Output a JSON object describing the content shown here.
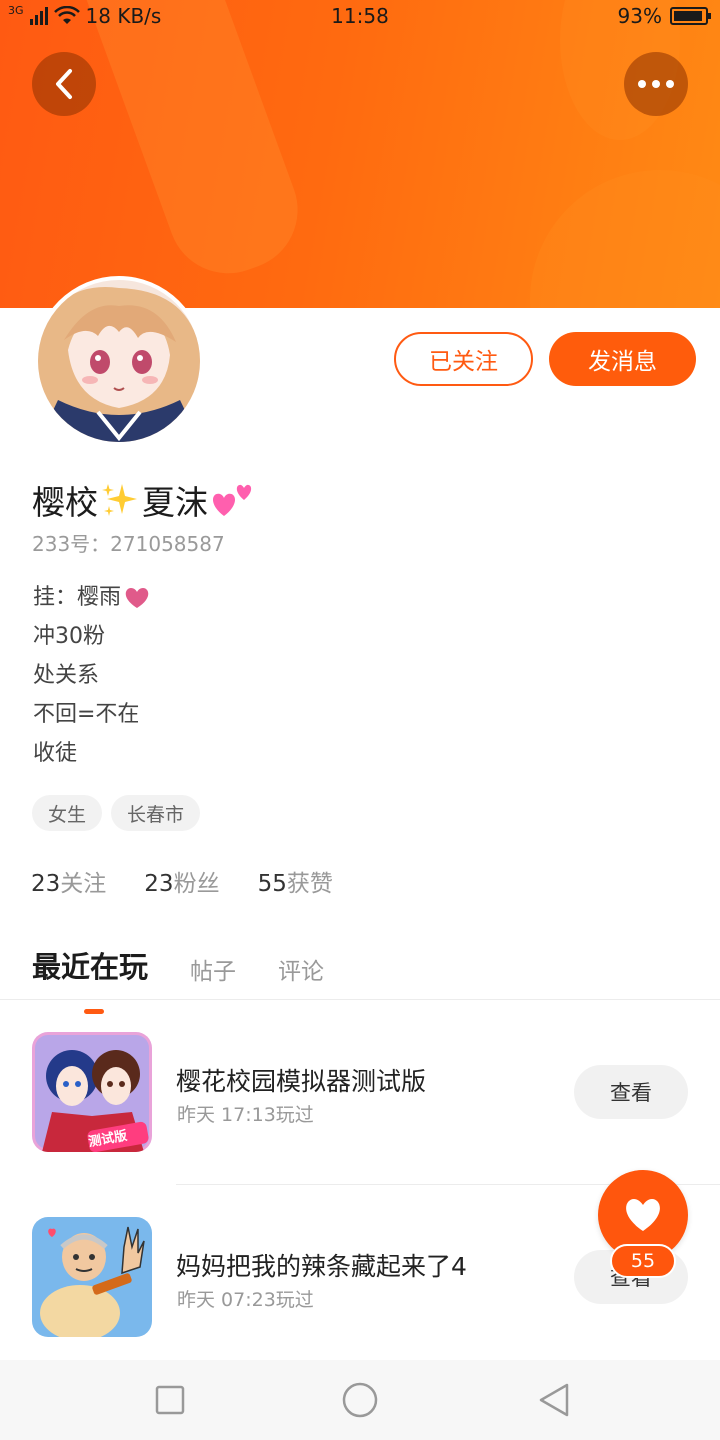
{
  "status_bar": {
    "network": "3G",
    "speed": "18 KB/s",
    "time": "11:58",
    "battery": "93%",
    "battery_level": 0.93
  },
  "header": {
    "back_icon": "chevron-left-icon",
    "more_icon": "more-dots-icon",
    "accent_color": "#ff5a12"
  },
  "profile": {
    "nickname": "樱校",
    "nickname_suffix": "夏沫",
    "uid": "233号：271058587",
    "bio_lines": [
      "挂：樱雨",
      "冲30粉",
      "处关系",
      "不回=不在",
      "收徒"
    ],
    "tags": [
      "女生",
      "长春市"
    ],
    "stats": [
      {
        "num": "23",
        "label": "关注"
      },
      {
        "num": "23",
        "label": "粉丝"
      },
      {
        "num": "55",
        "label": "获赞"
      }
    ]
  },
  "actions": {
    "follow_label": "已关注",
    "message_label": "发消息"
  },
  "tabs": [
    {
      "label": "最近在玩",
      "active": true
    },
    {
      "label": "帖子",
      "active": false
    },
    {
      "label": "评论",
      "active": false
    }
  ],
  "games": [
    {
      "title": "樱花校园模拟器测试版",
      "time": "昨天 17:13玩过",
      "button": "查看",
      "badge": "测试版"
    },
    {
      "title": "妈妈把我的辣条藏起来了4",
      "time": "昨天 07:23玩过",
      "button": "查看"
    }
  ],
  "fab": {
    "icon": "heart-icon",
    "count": "55"
  },
  "nav": [
    "square-icon",
    "circle-icon",
    "triangle-back-icon"
  ]
}
